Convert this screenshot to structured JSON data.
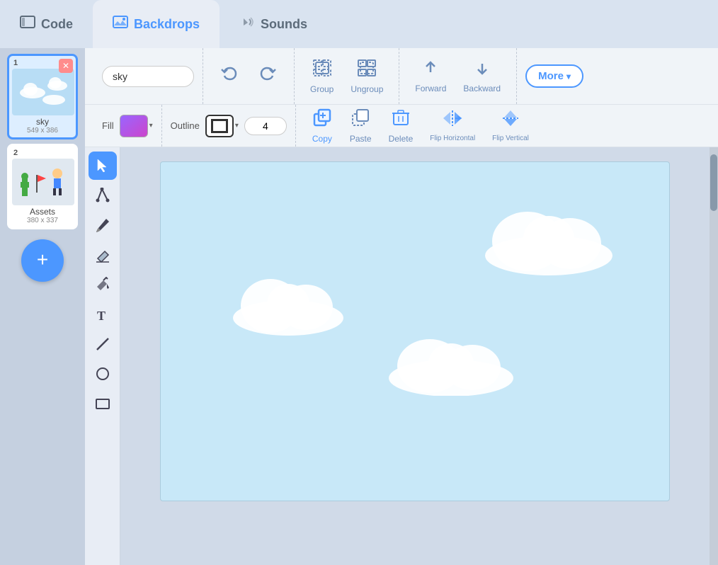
{
  "tabs": [
    {
      "id": "code",
      "label": "Code",
      "active": false
    },
    {
      "id": "backdrops",
      "label": "Backdrops",
      "active": true
    },
    {
      "id": "sounds",
      "label": "Sounds",
      "active": false
    }
  ],
  "sidebar": {
    "backdrops": [
      {
        "id": 1,
        "name": "sky",
        "size": "549 x 386",
        "selected": true,
        "type": "sky"
      },
      {
        "id": 2,
        "name": "Assets",
        "size": "380 x 337",
        "selected": false,
        "type": "assets"
      }
    ]
  },
  "toolbar": {
    "name_value": "sky",
    "name_placeholder": "sky",
    "group_label": "Group",
    "ungroup_label": "Ungroup",
    "forward_label": "Forward",
    "backward_label": "Backward",
    "more_label": "More",
    "copy_label": "Copy",
    "paste_label": "Paste",
    "delete_label": "Delete",
    "flip_horizontal_label": "Flip Horizontal",
    "flip_vertical_label": "Flip Vertical",
    "fill_label": "Fill",
    "outline_label": "Outline",
    "stroke_width": "4"
  },
  "tools": [
    {
      "id": "select",
      "label": "Select",
      "active": true,
      "icon": "cursor"
    },
    {
      "id": "reshape",
      "label": "Reshape",
      "active": false,
      "icon": "reshape"
    },
    {
      "id": "brush",
      "label": "Brush",
      "active": false,
      "icon": "brush"
    },
    {
      "id": "eraser",
      "label": "Eraser",
      "active": false,
      "icon": "eraser"
    },
    {
      "id": "fill",
      "label": "Fill",
      "active": false,
      "icon": "fill"
    },
    {
      "id": "text",
      "label": "Text",
      "active": false,
      "icon": "text"
    },
    {
      "id": "line",
      "label": "Line",
      "active": false,
      "icon": "line"
    },
    {
      "id": "circle",
      "label": "Circle",
      "active": false,
      "icon": "circle"
    },
    {
      "id": "rect",
      "label": "Rectangle",
      "active": false,
      "icon": "rect"
    }
  ],
  "canvas": {
    "backdrop_color": "#c8e8f8"
  }
}
